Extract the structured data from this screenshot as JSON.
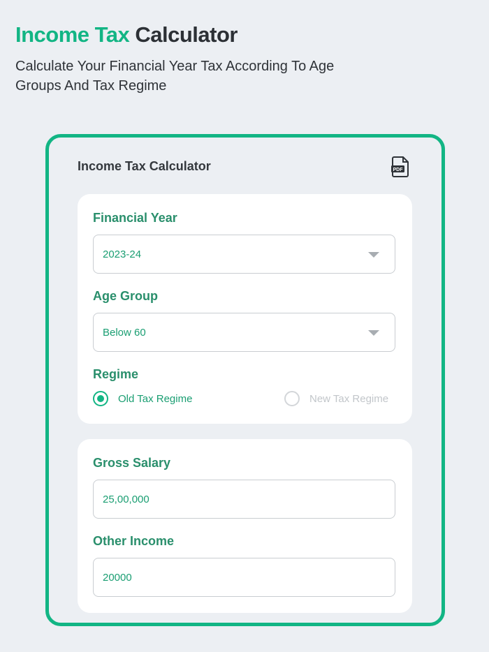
{
  "header": {
    "title_accent": "Income Tax",
    "title_rest": "Calculator",
    "subtitle": "Calculate Your Financial Year Tax According To Age Groups And Tax Regime"
  },
  "card": {
    "title": "Income Tax Calculator",
    "pdf_icon": "pdf-file-icon"
  },
  "form": {
    "financial_year": {
      "label": "Financial Year",
      "value": "2023-24"
    },
    "age_group": {
      "label": "Age Group",
      "value": "Below 60"
    },
    "regime": {
      "label": "Regime",
      "options": [
        "Old Tax Regime",
        "New Tax Regime"
      ],
      "selected": "Old Tax Regime"
    },
    "gross_salary": {
      "label": "Gross Salary",
      "value": "25,00,000"
    },
    "other_income": {
      "label": "Other Income",
      "value": "20000"
    }
  },
  "colors": {
    "accent": "#12b584",
    "label_green": "#2a8f6c",
    "background": "#eceff3"
  }
}
